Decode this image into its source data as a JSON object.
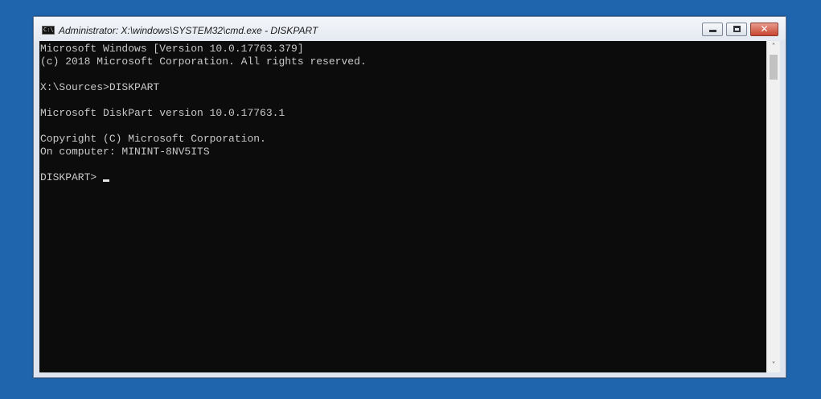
{
  "window": {
    "title": "Administrator: X:\\windows\\SYSTEM32\\cmd.exe - DISKPART",
    "icon_text": "C:\\",
    "icon": "console-app-icon",
    "minimize_icon": "minimize-icon",
    "maximize_icon": "maximize-icon",
    "close_icon": "close-icon",
    "close_glyph": "✕"
  },
  "console": {
    "lines": [
      "Microsoft Windows [Version 10.0.17763.379]",
      "(c) 2018 Microsoft Corporation. All rights reserved.",
      "",
      "X:\\Sources>DISKPART",
      "",
      "Microsoft DiskPart version 10.0.17763.1",
      "",
      "Copyright (C) Microsoft Corporation.",
      "On computer: MININT-8NV5ITS",
      ""
    ],
    "prompt": "DISKPART>"
  },
  "scrollbar": {
    "up_arrow": "˄",
    "down_arrow": "˅"
  },
  "colors": {
    "desktop": "#1f65ad",
    "console_bg": "#0c0c0c",
    "console_text": "#c8c8c8",
    "close_button": "#c8432f"
  }
}
